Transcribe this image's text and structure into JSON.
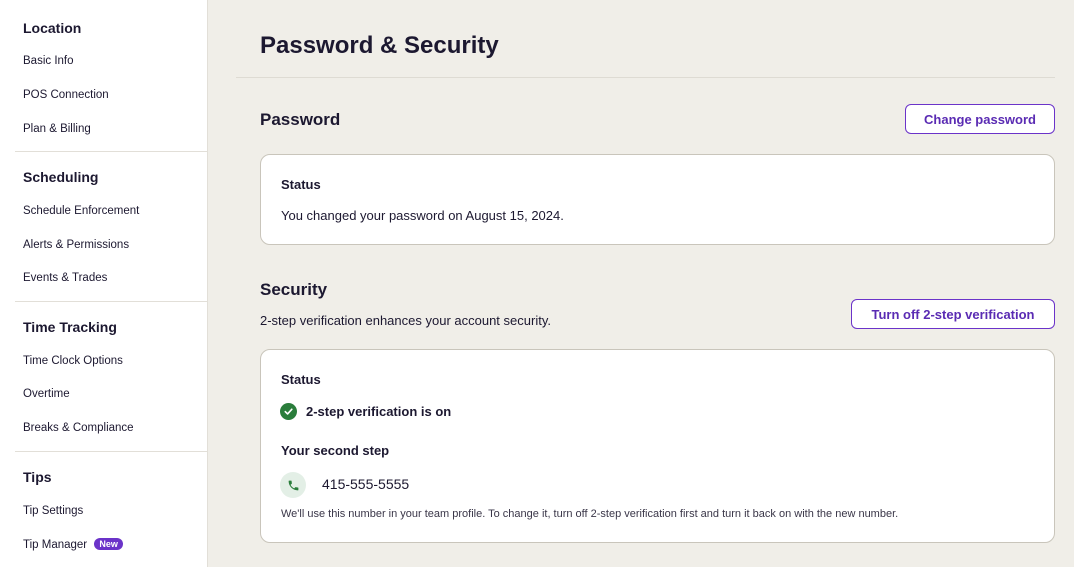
{
  "sidebar": {
    "sections": [
      {
        "title": "Location",
        "items": [
          "Basic Info",
          "POS Connection",
          "Plan & Billing"
        ]
      },
      {
        "title": "Scheduling",
        "items": [
          "Schedule Enforcement",
          "Alerts & Permissions",
          "Events & Trades"
        ]
      },
      {
        "title": "Time Tracking",
        "items": [
          "Time Clock Options",
          "Overtime",
          "Breaks & Compliance"
        ]
      },
      {
        "title": "Tips",
        "items": [
          "Tip Settings",
          "Tip Manager"
        ]
      }
    ],
    "badge_new": "New"
  },
  "main": {
    "page_title": "Password & Security",
    "password": {
      "heading": "Password",
      "change_button": "Change password",
      "status_label": "Status",
      "status_text": "You changed your password on August 15, 2024."
    },
    "security": {
      "heading": "Security",
      "description": "2-step verification enhances your account security.",
      "turn_off_button": "Turn off 2-step verification",
      "status_label": "Status",
      "status_text": "2-step verification is on",
      "second_step_label": "Your second step",
      "phone_number": "415-555-5555",
      "note": "We'll use this number in your team profile. To change it, turn off 2-step verification first and turn it back on with the new number."
    }
  },
  "colors": {
    "accent": "#6b33c9",
    "success": "#2a7d3b",
    "background": "#f0eee8"
  },
  "icons": {
    "status_ok": "check-circle-icon",
    "phone": "phone-icon"
  }
}
